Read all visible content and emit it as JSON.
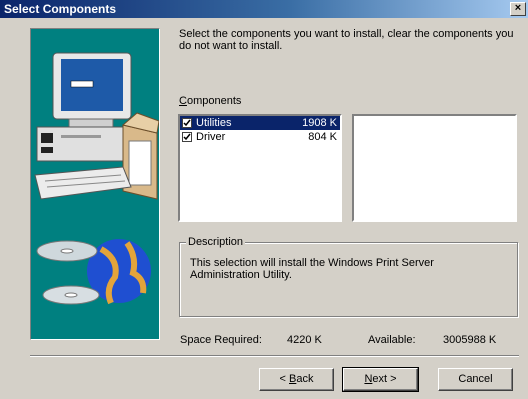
{
  "window": {
    "title": "Select Components",
    "close_glyph": "×"
  },
  "intro_text": "Select the components you want to install, clear the components you do not want to install.",
  "components_label": {
    "mnemonic": "C",
    "rest": "omponents"
  },
  "components": [
    {
      "name": "Utilities",
      "size": "1908 K",
      "checked": true,
      "selected": true
    },
    {
      "name": "Driver",
      "size": "804 K",
      "checked": true,
      "selected": false
    }
  ],
  "description": {
    "legend": "Description",
    "text": "This selection will install the Windows Print Server Administration Utility."
  },
  "space": {
    "required_label": "Space Required:",
    "required_value": "4220 K",
    "available_label": "Available:",
    "available_value": "3005988 K"
  },
  "buttons": {
    "back_prefix": "< ",
    "back_mnemonic": "B",
    "back_rest": "ack",
    "next_mnemonic": "N",
    "next_rest": "ext >",
    "cancel": "Cancel"
  },
  "icons": {
    "artwork": "computer-with-cds-icon",
    "checkbox": "checkmark-icon"
  },
  "colors": {
    "title_active": "#0a246a",
    "art_background": "#008080",
    "selection": "#0a246a",
    "face": "#d4d0c8"
  }
}
